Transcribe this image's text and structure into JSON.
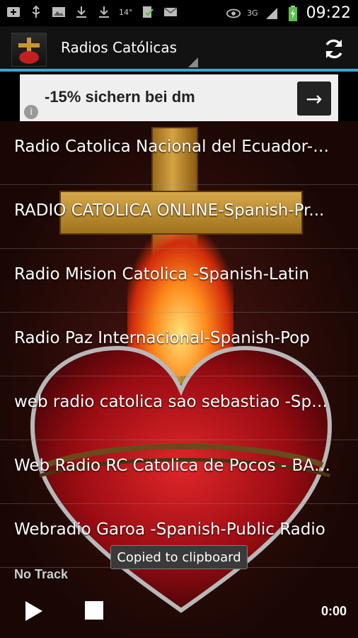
{
  "status_bar": {
    "time": "09:22",
    "temperature": "14°",
    "network": "3G",
    "left_icons": [
      "add-icon",
      "usb-icon",
      "image-icon",
      "download-icon",
      "download-icon"
    ],
    "right_icons": [
      "eye-icon",
      "signal-icon",
      "battery-icon"
    ]
  },
  "action_bar": {
    "title": "Radios Católicas",
    "accent_color": "#3aa6d6"
  },
  "ad": {
    "text": "-15% sichern bei dm",
    "arrow": "→",
    "info": "i"
  },
  "stations": [
    {
      "label": "Radio Catolica Nacional del Ecuador-Spanish-Public Radio"
    },
    {
      "label": "RADIO CATOLICA ONLINE-Spanish-Pr..."
    },
    {
      "label": "Radio Mision Catolica -Spanish-Latin"
    },
    {
      "label": "Radio Paz Internacional-Spanish-Pop"
    },
    {
      "label": "web radio catolica sao sebastiao -Spanish-Public Radio"
    },
    {
      "label": "Web Radio RC Catolica de Pocos - BA ..."
    },
    {
      "label": "Webradio Garoa -Spanish-Public Radio"
    }
  ],
  "player": {
    "now_playing": "No Track",
    "elapsed": "0:00"
  },
  "toast": {
    "text": "Copied to clipboard"
  }
}
